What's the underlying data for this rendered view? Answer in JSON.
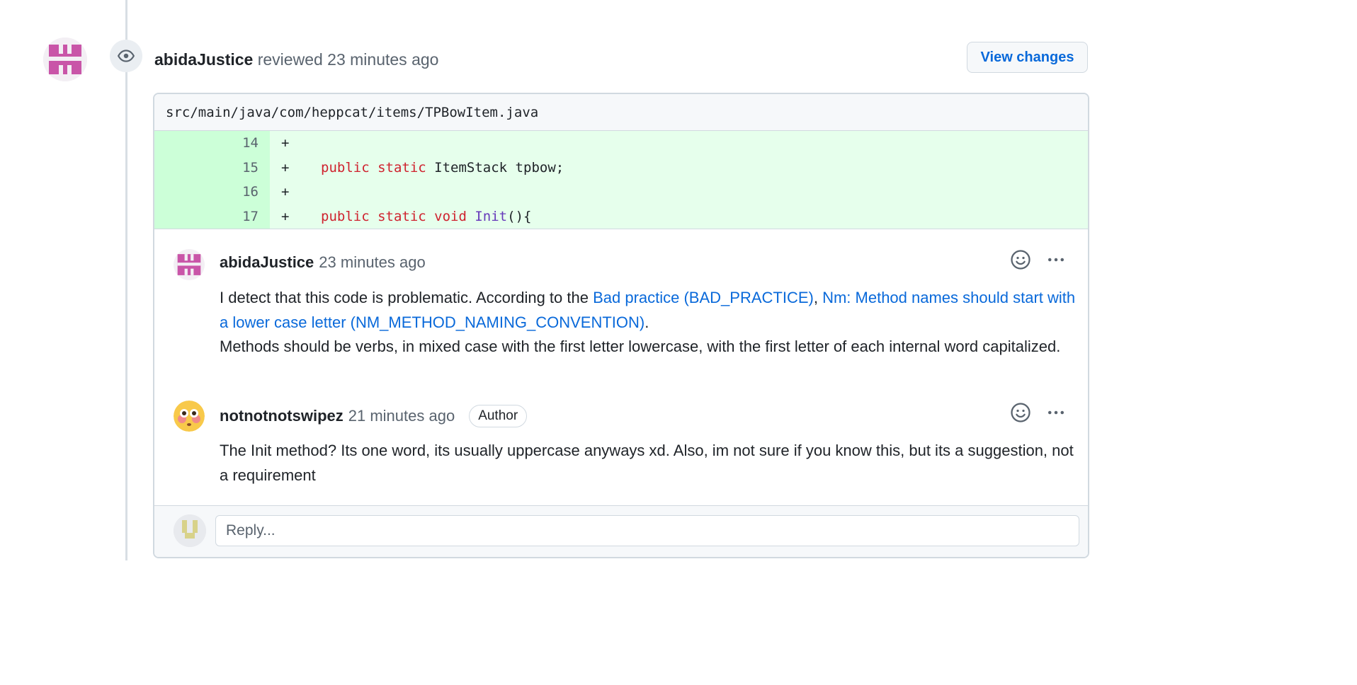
{
  "review": {
    "author": "abidaJustice",
    "action": "reviewed",
    "time": "23 minutes ago",
    "view_changes_label": "View changes"
  },
  "file": {
    "path": "src/main/java/com/heppcat/items/TPBowItem.java"
  },
  "diff": {
    "lines": [
      {
        "number": "14",
        "sign": "+"
      },
      {
        "number": "15",
        "sign": "+",
        "kw": "public static",
        "rest": "ItemStack tpbow;"
      },
      {
        "number": "16",
        "sign": "+"
      },
      {
        "number": "17",
        "sign": "+",
        "kw": "public static void",
        "fn": "Init",
        "rest": "(){"
      }
    ]
  },
  "comments": [
    {
      "author": "abidaJustice",
      "time": "23 minutes ago",
      "body_intro": "I detect that this code is problematic. According to the ",
      "link1": "Bad practice (BAD_PRACTICE)",
      "sep": ", ",
      "link2": "Nm: Method names should start with a lower case letter (NM_METHOD_NAMING_CONVENTION)",
      "body_period": ".",
      "body_rest": "Methods should be verbs, in mixed case with the first letter lowercase, with the first letter of each internal word capitalized."
    },
    {
      "author": "notnotnotswipez",
      "time": "21 minutes ago",
      "badge": "Author",
      "body": "The Init method? Its one word, its usually uppercase anyways xd. Also, im not sure if you know this, but its a suggestion, not a requirement"
    }
  ],
  "reply": {
    "placeholder": "Reply..."
  },
  "icons": {
    "eye": "eye-icon",
    "smiley": "smiley-icon",
    "kebab": "kebab-horizontal-icon"
  },
  "colors": {
    "link": "#0969da",
    "addition_bg": "#e6ffec",
    "addition_num_bg": "#ccffd8",
    "keyword": "#cf222e",
    "function": "#6639ba"
  }
}
